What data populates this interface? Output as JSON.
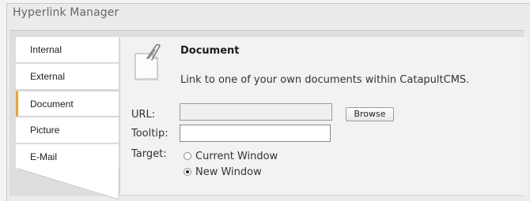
{
  "window": {
    "title": "Hyperlink Manager"
  },
  "tabs": [
    {
      "label": "Internal",
      "active": false
    },
    {
      "label": "External",
      "active": false
    },
    {
      "label": "Document",
      "active": true
    },
    {
      "label": "Picture",
      "active": false
    },
    {
      "label": "E-Mail",
      "active": false
    }
  ],
  "content": {
    "icon": "document-paperclip-icon",
    "heading": "Document",
    "description": "Link to one of your own documents within CatapultCMS.",
    "url": {
      "label": "URL:",
      "value": "",
      "disabled": true
    },
    "browse_label": "Browse",
    "tooltip": {
      "label": "Tooltip:",
      "value": ""
    },
    "target": {
      "label": "Target:",
      "options": [
        {
          "label": "Current Window",
          "selected": false
        },
        {
          "label": "New Window",
          "selected": true
        }
      ]
    }
  },
  "colors": {
    "active_tab_accent": "#e8a33a",
    "panel_bg": "#dedede",
    "content_bg": "#f2f2f2"
  }
}
